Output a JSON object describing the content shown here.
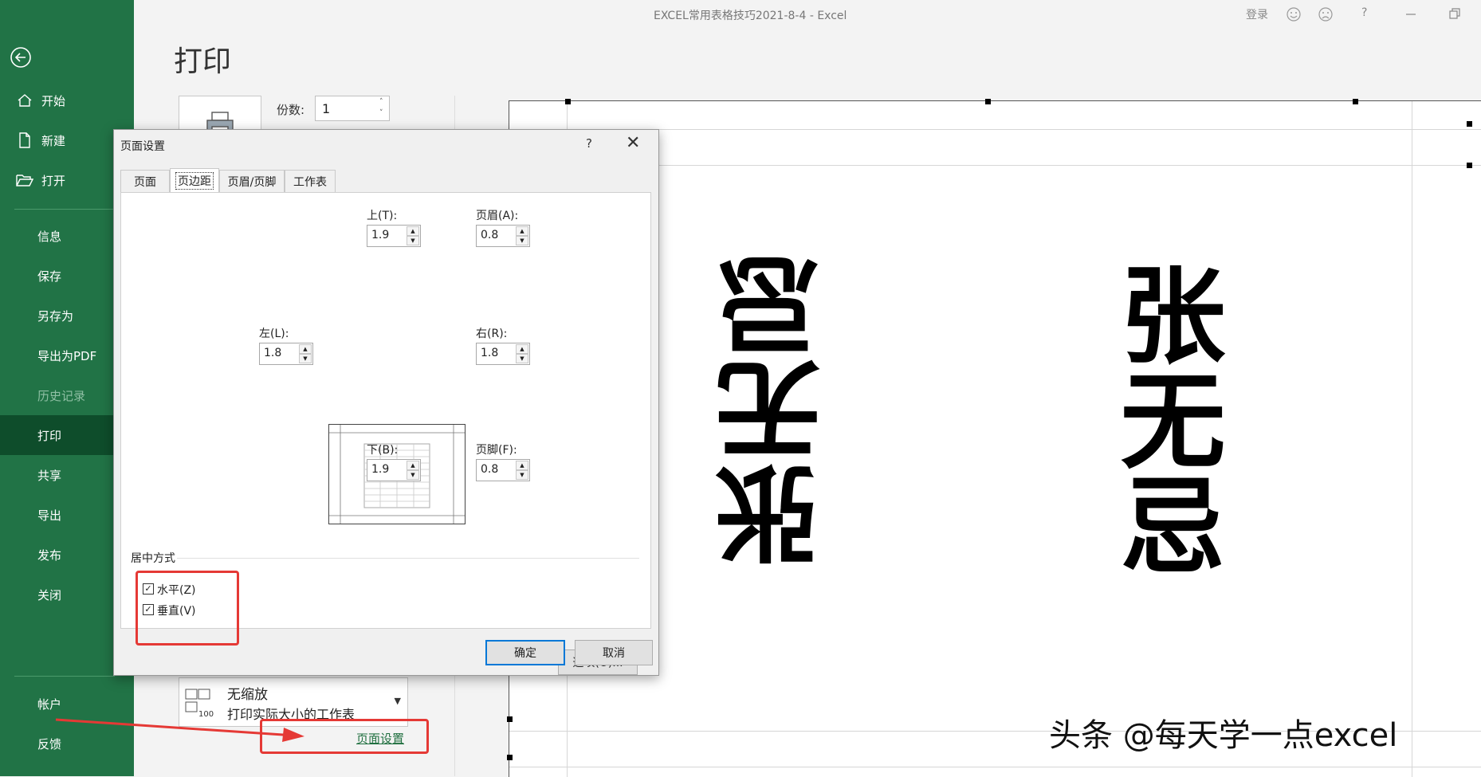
{
  "window": {
    "title": "EXCEL常用表格技巧2021-8-4  -  Excel",
    "signin": "登录",
    "help": "?"
  },
  "sidebar": {
    "items": [
      {
        "label": "开始",
        "icon": "home-icon"
      },
      {
        "label": "新建",
        "icon": "new-file-icon"
      },
      {
        "label": "打开",
        "icon": "folder-open-icon"
      },
      {
        "label": "信息"
      },
      {
        "label": "保存"
      },
      {
        "label": "另存为"
      },
      {
        "label": "导出为PDF"
      },
      {
        "label": "历史记录",
        "disabled": true
      },
      {
        "label": "打印",
        "active": true
      },
      {
        "label": "共享"
      },
      {
        "label": "导出"
      },
      {
        "label": "发布"
      },
      {
        "label": "关闭"
      },
      {
        "label": "帐户"
      },
      {
        "label": "反馈"
      }
    ]
  },
  "print": {
    "title": "打印",
    "copies_label": "份数:",
    "copies_value": "1",
    "scaling_title": "无缩放",
    "scaling_desc": "打印实际大小的工作表",
    "scaling_icon_text": "100",
    "page_setup_link": "页面设置"
  },
  "preview": {
    "left_text": "张无忌",
    "right_text": "张无忌"
  },
  "watermark": "头条 @每天学一点excel",
  "dialog": {
    "title": "页面设置",
    "help": "?",
    "close": "✕",
    "tabs": [
      "页面",
      "页边距",
      "页眉/页脚",
      "工作表"
    ],
    "active_tab": "页边距",
    "fields": {
      "top": {
        "label": "上(T):",
        "value": "1.9"
      },
      "header": {
        "label": "页眉(A):",
        "value": "0.8"
      },
      "left": {
        "label": "左(L):",
        "value": "1.8"
      },
      "right": {
        "label": "右(R):",
        "value": "1.8"
      },
      "bottom": {
        "label": "下(B):",
        "value": "1.9"
      },
      "footer": {
        "label": "页脚(F):",
        "value": "0.8"
      }
    },
    "center_group": "居中方式",
    "horizontal": {
      "label": "水平(Z)",
      "checked": true
    },
    "vertical": {
      "label": "垂直(V)",
      "checked": true
    },
    "options_button": "选项(O)...",
    "ok_button": "确定",
    "cancel_button": "取消"
  },
  "colors": {
    "sidebar_bg": "#217346",
    "sidebar_active": "#0e4d2b",
    "highlight": "#e53935",
    "primary_border": "#0078d7"
  }
}
